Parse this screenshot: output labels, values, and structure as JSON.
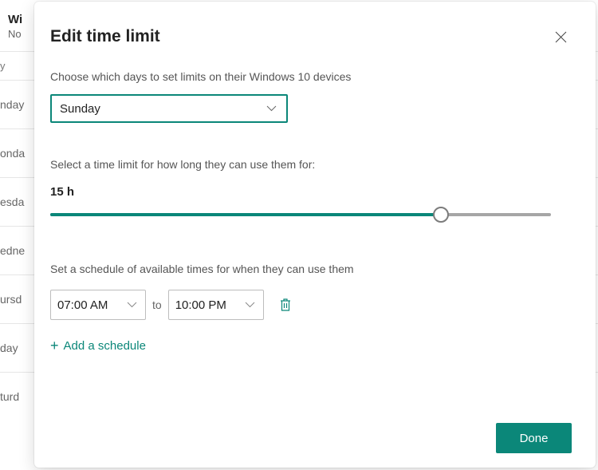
{
  "background": {
    "title": "Wi",
    "subtitle": "No",
    "day_col": "y",
    "days": [
      "nday",
      "onda",
      "esda",
      "edne",
      "ursd",
      "day",
      "turd"
    ]
  },
  "modal": {
    "title": "Edit time limit",
    "days_desc": "Choose which days to set limits on their Windows 10 devices",
    "selected_day": "Sunday",
    "limit_desc": "Select a time limit for how long they can use them for:",
    "hours_value": "15 h",
    "slider_percent": 78,
    "schedule_desc": "Set a schedule of available times for when they can use them",
    "schedule": {
      "from": "07:00 AM",
      "to_label": "to",
      "to": "10:00 PM"
    },
    "add_schedule_label": "Add a schedule",
    "done_label": "Done"
  }
}
